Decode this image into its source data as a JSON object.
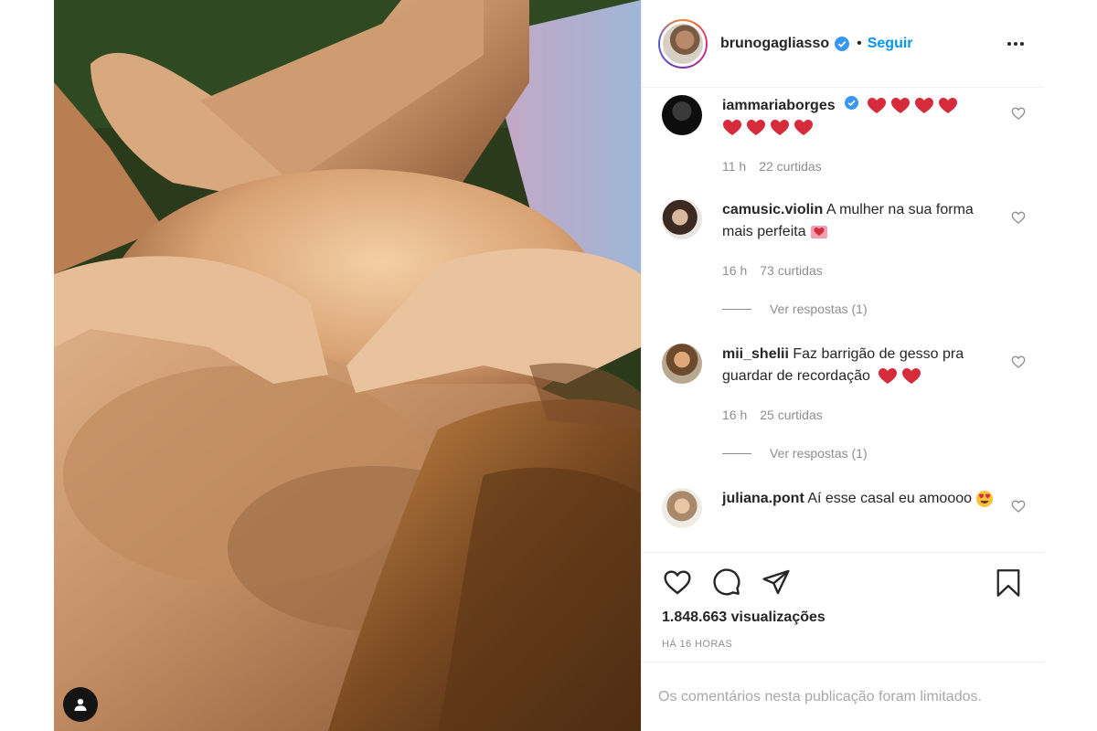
{
  "header": {
    "username": "brunogagliasso",
    "dot": "•",
    "follow_label": "Seguir"
  },
  "comments": [
    {
      "username": "iammariaborges",
      "text": "",
      "hearts": 8,
      "time": "11 h",
      "likes": "22 curtidas",
      "replies": ""
    },
    {
      "username": "camusic.violin",
      "text": "A mulher na sua forma mais perfeita",
      "emoji": "love-letter",
      "time": "16 h",
      "likes": "73 curtidas",
      "replies": "Ver respostas (1)"
    },
    {
      "username": "mii_shelii",
      "text": "Faz barrigão de gesso pra guardar de recordação",
      "hearts": 2,
      "time": "16 h",
      "likes": "25 curtidas",
      "replies": "Ver respostas (1)"
    },
    {
      "username": "juliana.pont",
      "text": "Aí esse casal eu amoooo",
      "emoji": "heart-eyes",
      "time": "",
      "likes": "",
      "replies": ""
    }
  ],
  "footer": {
    "views": "1.848.663 visualizações",
    "time": "HÁ 16 HORAS",
    "limited": "Os comentários nesta publicação foram limitados."
  },
  "colors": {
    "accent": "#0095f6",
    "heart": "#d62b3a",
    "muted": "#8e8e8e"
  },
  "icons": [
    "tag-user-icon",
    "verified-badge-icon",
    "more-options-icon",
    "like-icon",
    "comment-icon",
    "share-icon",
    "save-icon",
    "heart-emoji-icon",
    "love-letter-emoji-icon",
    "heart-eyes-emoji-icon"
  ]
}
